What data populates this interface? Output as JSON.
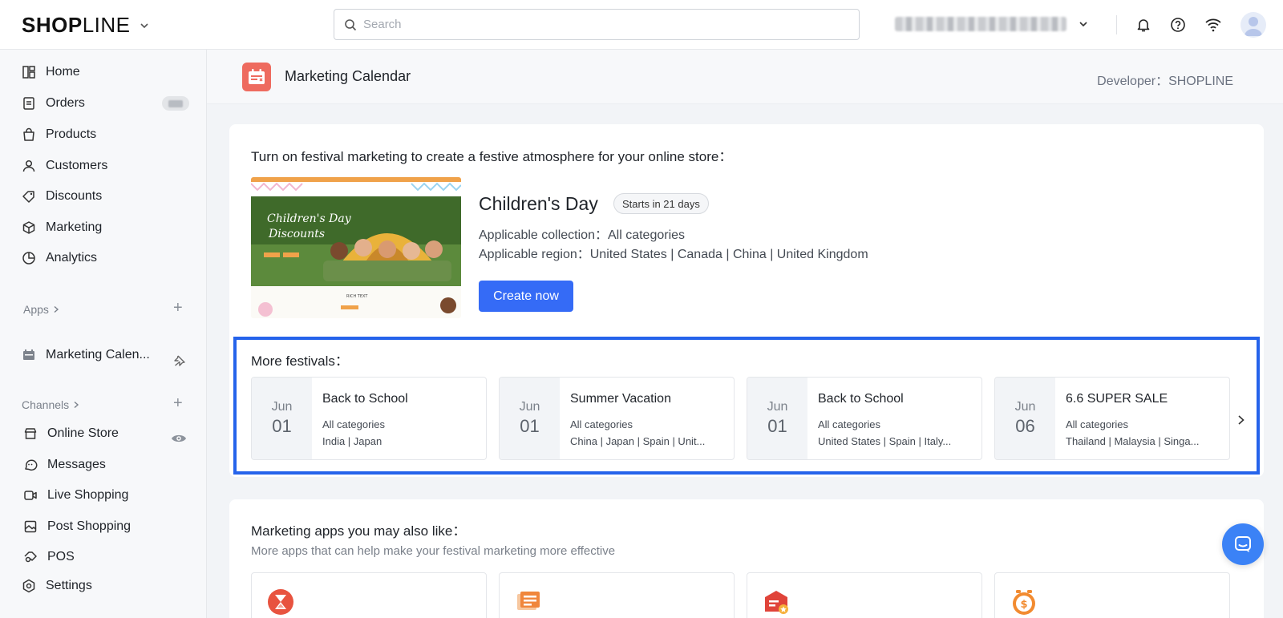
{
  "header": {
    "logo_text_bold": "SHOP",
    "logo_text_light": "LINE",
    "search": {
      "placeholder": "Search",
      "value": ""
    }
  },
  "sidebar": {
    "items": [
      {
        "label": "Home",
        "icon": "home-icon"
      },
      {
        "label": "Orders",
        "icon": "orders-icon"
      },
      {
        "label": "Products",
        "icon": "products-icon"
      },
      {
        "label": "Customers",
        "icon": "customers-icon"
      },
      {
        "label": "Discounts",
        "icon": "discounts-icon"
      },
      {
        "label": "Marketing",
        "icon": "marketing-icon"
      },
      {
        "label": "Analytics",
        "icon": "analytics-icon"
      }
    ],
    "apps_label": "Apps",
    "apps_items": [
      {
        "label": "Marketing Calen...",
        "icon": "calendar-app-icon"
      }
    ],
    "channels_label": "Channels",
    "channel_items": [
      {
        "label": "Online Store",
        "icon": "store-icon"
      },
      {
        "label": "Messages",
        "icon": "messages-icon"
      },
      {
        "label": "Live Shopping",
        "icon": "live-shopping-icon"
      },
      {
        "label": "Post Shopping",
        "icon": "post-shopping-icon"
      },
      {
        "label": "POS",
        "icon": "pos-icon"
      }
    ],
    "settings_label": "Settings"
  },
  "app_header": {
    "title": "Marketing Calendar",
    "developer": "Developer：SHOPLINE"
  },
  "promo": {
    "heading": "Turn on festival marketing to create a festive atmosphere for your online store：",
    "banner": {
      "line1": "Children's Day",
      "line2": "Discounts",
      "rich_text": "RICH TEXT"
    },
    "festival_name": "Children's Day",
    "starts_badge": "Starts in 21 days",
    "collection_line": "Applicable collection：All categories",
    "region_line": "Applicable region：United States | Canada | China | United Kingdom",
    "create_button": "Create now"
  },
  "more_festivals": {
    "heading": "More festivals：",
    "items": [
      {
        "month": "Jun",
        "day": "01",
        "name": "Back to School",
        "collection": "All categories",
        "region": "India | Japan"
      },
      {
        "month": "Jun",
        "day": "01",
        "name": "Summer Vacation",
        "collection": "All categories",
        "region": "China | Japan | Spain | Unit..."
      },
      {
        "month": "Jun",
        "day": "01",
        "name": "Back to School",
        "collection": "All categories",
        "region": "United States | Spain | Italy..."
      },
      {
        "month": "Jun",
        "day": "06",
        "name": "6.6 SUPER SALE",
        "collection": "All categories",
        "region": "Thailand | Malaysia | Singa..."
      }
    ]
  },
  "apps_section": {
    "heading": "Marketing apps you may also like：",
    "subheading": "More apps that can help make your festival marketing more effective",
    "tiles": [
      {
        "icon": "hourglass-icon",
        "color": "#e8533f"
      },
      {
        "icon": "news-icon",
        "color": "#f0863c"
      },
      {
        "icon": "coupon-shop-icon",
        "color": "#e0443a"
      },
      {
        "icon": "dollar-clock-icon",
        "color": "#f28b30"
      }
    ]
  },
  "colors": {
    "primary": "#356bf6",
    "highlight_border": "#2563eb",
    "app_logo": "#ee6b5f"
  }
}
